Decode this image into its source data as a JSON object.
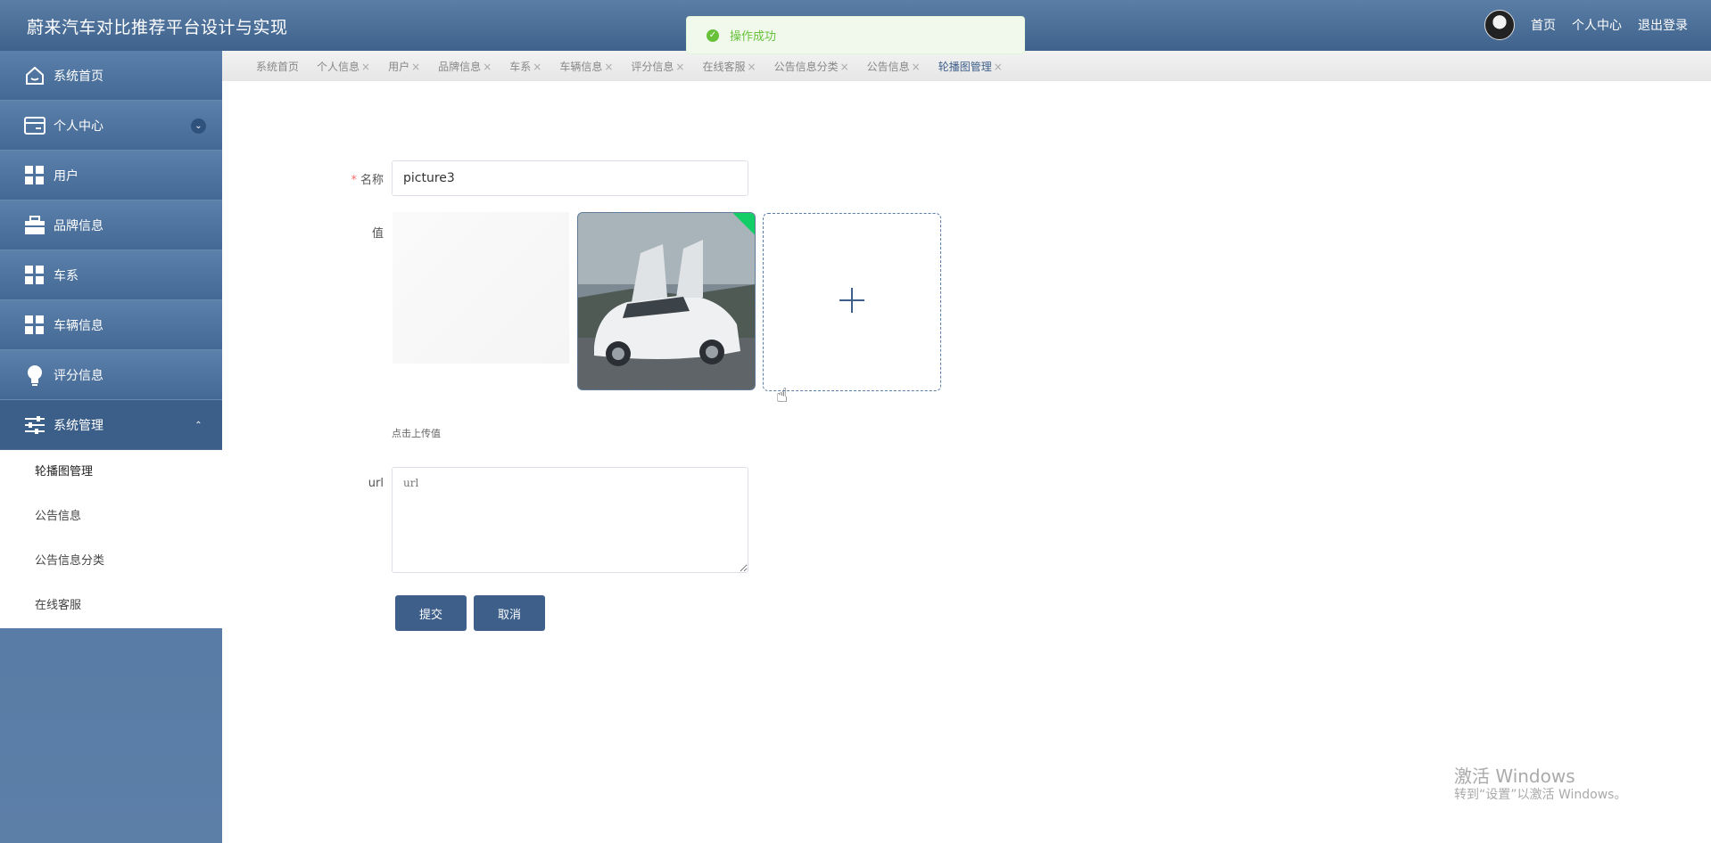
{
  "app": {
    "title": "蔚来汽车对比推荐平台设计与实现"
  },
  "header": {
    "links": [
      "首页",
      "个人中心",
      "退出登录"
    ]
  },
  "toast": {
    "message": "操作成功"
  },
  "sidebar": {
    "items": [
      {
        "label": "系统首页",
        "icon": "home-icon"
      },
      {
        "label": "个人中心",
        "icon": "wallet-icon"
      },
      {
        "label": "用户",
        "icon": "grid-icon"
      },
      {
        "label": "品牌信息",
        "icon": "briefcase-icon"
      },
      {
        "label": "车系",
        "icon": "grid-icon"
      },
      {
        "label": "车辆信息",
        "icon": "grid-icon"
      },
      {
        "label": "评分信息",
        "icon": "bulb-icon"
      },
      {
        "label": "系统管理",
        "icon": "sliders-icon"
      }
    ],
    "submenu": [
      "轮播图管理",
      "公告信息",
      "公告信息分类",
      "在线客服"
    ]
  },
  "tabs": [
    "系统首页",
    "个人信息",
    "用户",
    "品牌信息",
    "车系",
    "车辆信息",
    "评分信息",
    "在线客服",
    "公告信息分类",
    "公告信息",
    "轮播图管理"
  ],
  "form": {
    "name_label": "名称",
    "name_value": "picture3",
    "value_label": "值",
    "upload_hint": "点击上传值",
    "url_label": "url",
    "url_placeholder": "url",
    "submit": "提交",
    "cancel": "取消"
  },
  "watermark": {
    "line1": "激活 Windows",
    "line2": "转到“设置”以激活 Windows。"
  }
}
